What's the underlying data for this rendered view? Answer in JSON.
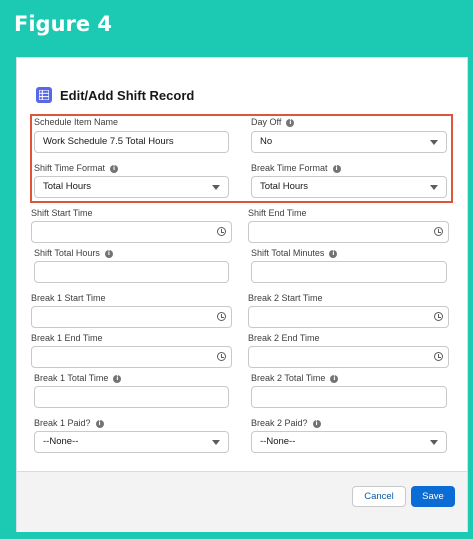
{
  "figure_label": "Figure 4",
  "modal": {
    "title": "Edit/Add Shift Record",
    "icon": "record-icon"
  },
  "fields": {
    "schedule_item_name": {
      "label": "Schedule Item Name",
      "value": "Work Schedule 7.5 Total Hours"
    },
    "day_off": {
      "label": "Day Off",
      "value": "No"
    },
    "shift_time_format": {
      "label": "Shift Time Format",
      "value": "Total Hours"
    },
    "break_time_format": {
      "label": "Break Time Format",
      "value": "Total Hours"
    },
    "shift_start_time": {
      "label": "Shift Start Time",
      "value": ""
    },
    "shift_end_time": {
      "label": "Shift End Time",
      "value": ""
    },
    "shift_total_hours": {
      "label": "Shift Total Hours",
      "value": ""
    },
    "shift_total_minutes": {
      "label": "Shift Total Minutes",
      "value": ""
    },
    "break1_start_time": {
      "label": "Break 1 Start Time",
      "value": ""
    },
    "break2_start_time": {
      "label": "Break 2 Start Time",
      "value": ""
    },
    "break1_end_time": {
      "label": "Break 1 End Time",
      "value": ""
    },
    "break2_end_time": {
      "label": "Break 2 End Time",
      "value": ""
    },
    "break1_total_time": {
      "label": "Break 1 Total Time",
      "value": ""
    },
    "break2_total_time": {
      "label": "Break 2 Total Time",
      "value": ""
    },
    "break1_paid": {
      "label": "Break 1 Paid?",
      "value": "--None--"
    },
    "break2_paid": {
      "label": "Break 2 Paid?",
      "value": "--None--"
    }
  },
  "footer": {
    "cancel_label": "Cancel",
    "save_label": "Save"
  },
  "colors": {
    "background": "#1cc9b3",
    "highlight_border": "#e0553a",
    "save_button": "#0b6cd6",
    "modal_icon": "#5867e8"
  }
}
